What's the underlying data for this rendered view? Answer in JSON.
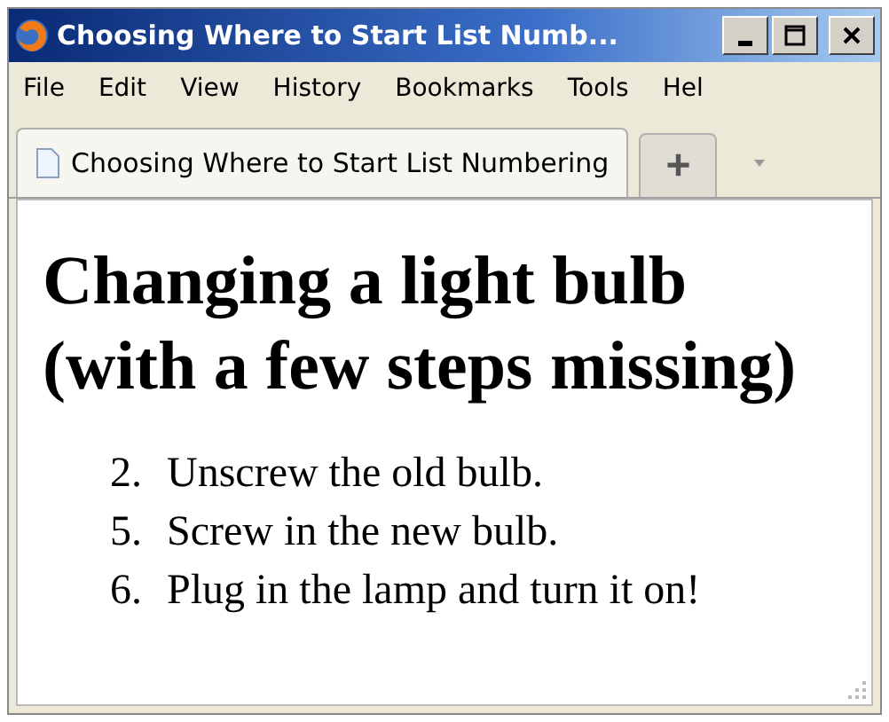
{
  "window": {
    "title": "Choosing Where to Start List Numb..."
  },
  "menu": [
    "File",
    "Edit",
    "View",
    "History",
    "Bookmarks",
    "Tools",
    "Hel"
  ],
  "tabs": [
    {
      "label": "Choosing Where to Start List Numbering",
      "selected": true
    }
  ],
  "new_tab": "+",
  "page": {
    "heading": "Changing a light bulb (with a few steps missing)",
    "list": [
      {
        "number": "2.",
        "text": "Unscrew the old bulb."
      },
      {
        "number": "5.",
        "text": "Screw in the new bulb."
      },
      {
        "number": "6.",
        "text": "Plug in the lamp and turn it on!"
      }
    ]
  }
}
